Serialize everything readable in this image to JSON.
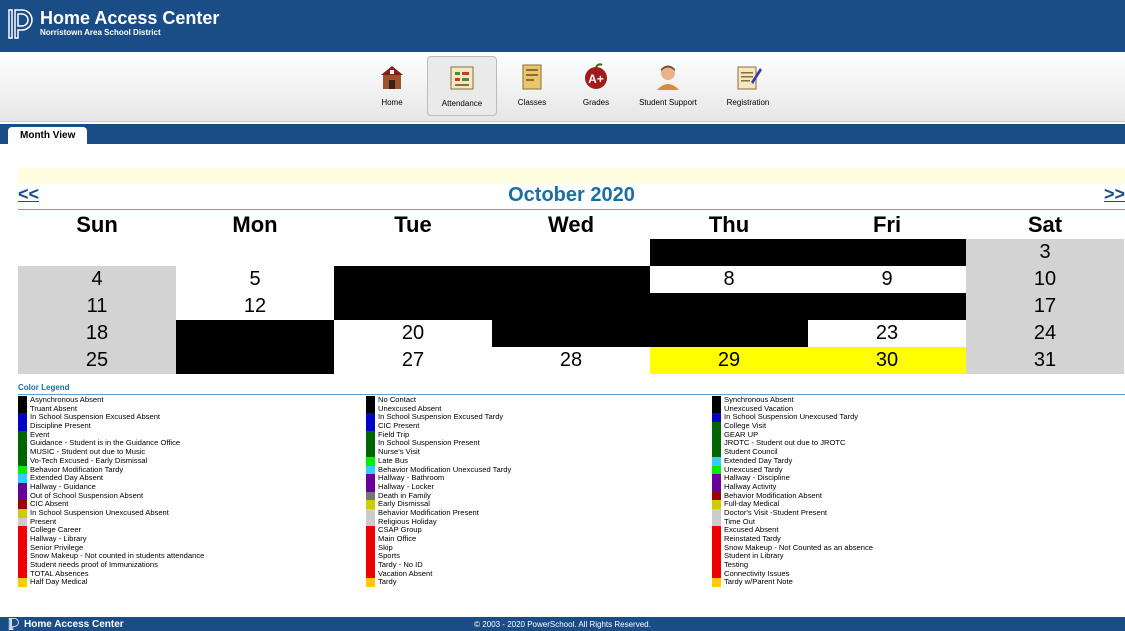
{
  "header": {
    "app_title": "Home Access Center",
    "district": "Norristown Area School District"
  },
  "nav": [
    {
      "label": "Home",
      "icon": "school-house-icon"
    },
    {
      "label": "Attendance",
      "icon": "attendance-chart-icon",
      "active": true
    },
    {
      "label": "Classes",
      "icon": "notebook-icon"
    },
    {
      "label": "Grades",
      "icon": "grade-apple-icon"
    },
    {
      "label": "Student Support",
      "icon": "student-avatar-icon"
    },
    {
      "label": "Registration",
      "icon": "registration-form-icon"
    }
  ],
  "tab": {
    "label": "Month View"
  },
  "calendar": {
    "prev": "<<",
    "next": ">>",
    "month_title": "October 2020",
    "days_of_week": [
      "Sun",
      "Mon",
      "Tue",
      "Wed",
      "Thu",
      "Fri",
      "Sat"
    ],
    "weeks": [
      [
        {
          "n": "",
          "c": "white"
        },
        {
          "n": "",
          "c": "white"
        },
        {
          "n": "",
          "c": "white"
        },
        {
          "n": "",
          "c": "white"
        },
        {
          "n": "",
          "c": "black"
        },
        {
          "n": "",
          "c": "black"
        },
        {
          "n": "3",
          "c": "gray"
        }
      ],
      [
        {
          "n": "4",
          "c": "gray"
        },
        {
          "n": "5",
          "c": "white"
        },
        {
          "n": "",
          "c": "black"
        },
        {
          "n": "",
          "c": "black"
        },
        {
          "n": "8",
          "c": "white"
        },
        {
          "n": "9",
          "c": "white"
        },
        {
          "n": "10",
          "c": "gray"
        }
      ],
      [
        {
          "n": "11",
          "c": "gray"
        },
        {
          "n": "12",
          "c": "white"
        },
        {
          "n": "",
          "c": "black"
        },
        {
          "n": "",
          "c": "black"
        },
        {
          "n": "",
          "c": "black"
        },
        {
          "n": "",
          "c": "black"
        },
        {
          "n": "17",
          "c": "gray"
        }
      ],
      [
        {
          "n": "18",
          "c": "gray"
        },
        {
          "n": "",
          "c": "black"
        },
        {
          "n": "20",
          "c": "white"
        },
        {
          "n": "",
          "c": "black"
        },
        {
          "n": "",
          "c": "black"
        },
        {
          "n": "23",
          "c": "white"
        },
        {
          "n": "24",
          "c": "gray"
        }
      ],
      [
        {
          "n": "25",
          "c": "gray"
        },
        {
          "n": "",
          "c": "black"
        },
        {
          "n": "27",
          "c": "white"
        },
        {
          "n": "28",
          "c": "white"
        },
        {
          "n": "29",
          "c": "yellow"
        },
        {
          "n": "30",
          "c": "yellow"
        },
        {
          "n": "31",
          "c": "gray"
        }
      ]
    ]
  },
  "legend": {
    "title": "Color Legend",
    "columns": [
      [
        {
          "label": "Asynchronous Absent",
          "color": "#000000"
        },
        {
          "label": "Truant Absent",
          "color": "#000000"
        },
        {
          "label": "In School Suspension Excused Absent",
          "color": "#0000cc"
        },
        {
          "label": "Discipline Present",
          "color": "#0000cc"
        },
        {
          "label": "Event",
          "color": "#006400"
        },
        {
          "label": "Guidance - Student is in the Guidance Office",
          "color": "#006400"
        },
        {
          "label": "MUSIC - Student out due to Music",
          "color": "#006400"
        },
        {
          "label": "Vo-Tech Excused - Early Dismissal",
          "color": "#006400"
        },
        {
          "label": "Behavior Modification Tardy",
          "color": "#00ee00"
        },
        {
          "label": "Extended Day Absent",
          "color": "#33ccff"
        },
        {
          "label": "Hallway - Guidance",
          "color": "#660099"
        },
        {
          "label": "Out of School Suspension Absent",
          "color": "#660099"
        },
        {
          "label": "CIC Absent",
          "color": "#990000"
        },
        {
          "label": "In School Suspension Unexcused Absent",
          "color": "#cccc00"
        },
        {
          "label": "Present",
          "color": "#cccccc"
        },
        {
          "label": "College Career",
          "color": "#ee0000"
        },
        {
          "label": "Hallway - Library",
          "color": "#ee0000"
        },
        {
          "label": "Senior Privilege",
          "color": "#ee0000"
        },
        {
          "label": "Snow Makeup - Not counted in students attendance",
          "color": "#ee0000"
        },
        {
          "label": "Student needs proof of Immunizations",
          "color": "#ee0000"
        },
        {
          "label": "TOTAL Absences",
          "color": "#ee0000"
        },
        {
          "label": "Half Day Medical",
          "color": "#ffcc00"
        }
      ],
      [
        {
          "label": "No Contact",
          "color": "#000000"
        },
        {
          "label": "Unexcused Absent",
          "color": "#000000"
        },
        {
          "label": "In School Suspension Excused Tardy",
          "color": "#0000cc"
        },
        {
          "label": "CIC Present",
          "color": "#0000cc"
        },
        {
          "label": "Field Trip",
          "color": "#006400"
        },
        {
          "label": "In School Suspension Present",
          "color": "#006400"
        },
        {
          "label": "Nurse's Visit",
          "color": "#006400"
        },
        {
          "label": "Late Bus",
          "color": "#00ee00"
        },
        {
          "label": "Behavior Modification Unexcused Tardy",
          "color": "#33ccff"
        },
        {
          "label": "Hallway - Bathroom",
          "color": "#660099"
        },
        {
          "label": "Hallway - Locker",
          "color": "#660099"
        },
        {
          "label": "Death in Family",
          "color": "#777777"
        },
        {
          "label": "Early Dismissal",
          "color": "#cccc00"
        },
        {
          "label": "Behavior Modification Present",
          "color": "#cccccc"
        },
        {
          "label": "Religious Holiday",
          "color": "#cccccc"
        },
        {
          "label": "CSAP Group",
          "color": "#ee0000"
        },
        {
          "label": "Main Office",
          "color": "#ee0000"
        },
        {
          "label": "Skip",
          "color": "#ee0000"
        },
        {
          "label": "Sports",
          "color": "#ee0000"
        },
        {
          "label": "Tardy - No ID",
          "color": "#ee0000"
        },
        {
          "label": "Vacation Absent",
          "color": "#ee0000"
        },
        {
          "label": "Tardy",
          "color": "#ffcc00"
        }
      ],
      [
        {
          "label": "Synchronous Absent",
          "color": "#000000"
        },
        {
          "label": "Unexcused Vacation",
          "color": "#000000"
        },
        {
          "label": "In School Suspension Unexcused Tardy",
          "color": "#0000cc"
        },
        {
          "label": "College Visit",
          "color": "#006400"
        },
        {
          "label": "GEAR UP",
          "color": "#006400"
        },
        {
          "label": "JROTC - Student out due to JROTC",
          "color": "#006400"
        },
        {
          "label": "Student Council",
          "color": "#006400"
        },
        {
          "label": "Extended Day Tardy",
          "color": "#33ccff"
        },
        {
          "label": "Unexcused Tardy",
          "color": "#00ee00"
        },
        {
          "label": "Hallway - Discipline",
          "color": "#660099"
        },
        {
          "label": "Hallway Activity",
          "color": "#660099"
        },
        {
          "label": "Behavior Modification Absent",
          "color": "#990000"
        },
        {
          "label": "Full-day Medical",
          "color": "#cccc00"
        },
        {
          "label": "Doctor's Visit -Student Present",
          "color": "#cccccc"
        },
        {
          "label": "Time Out",
          "color": "#cccccc"
        },
        {
          "label": "Excused Absent",
          "color": "#ee0000"
        },
        {
          "label": "Reinstated Tardy",
          "color": "#ee0000"
        },
        {
          "label": "Snow Makeup - Not Counted as an absence",
          "color": "#ee0000"
        },
        {
          "label": "Student in Library",
          "color": "#ee0000"
        },
        {
          "label": "Testing",
          "color": "#ee0000"
        },
        {
          "label": "Connectivity Issues",
          "color": "#ee0000"
        },
        {
          "label": "Tardy w/Parent Note",
          "color": "#ffcc00"
        }
      ]
    ]
  },
  "footer": {
    "app_title": "Home Access Center",
    "copyright": "© 2003 - 2020 PowerSchool. All Rights Reserved."
  }
}
